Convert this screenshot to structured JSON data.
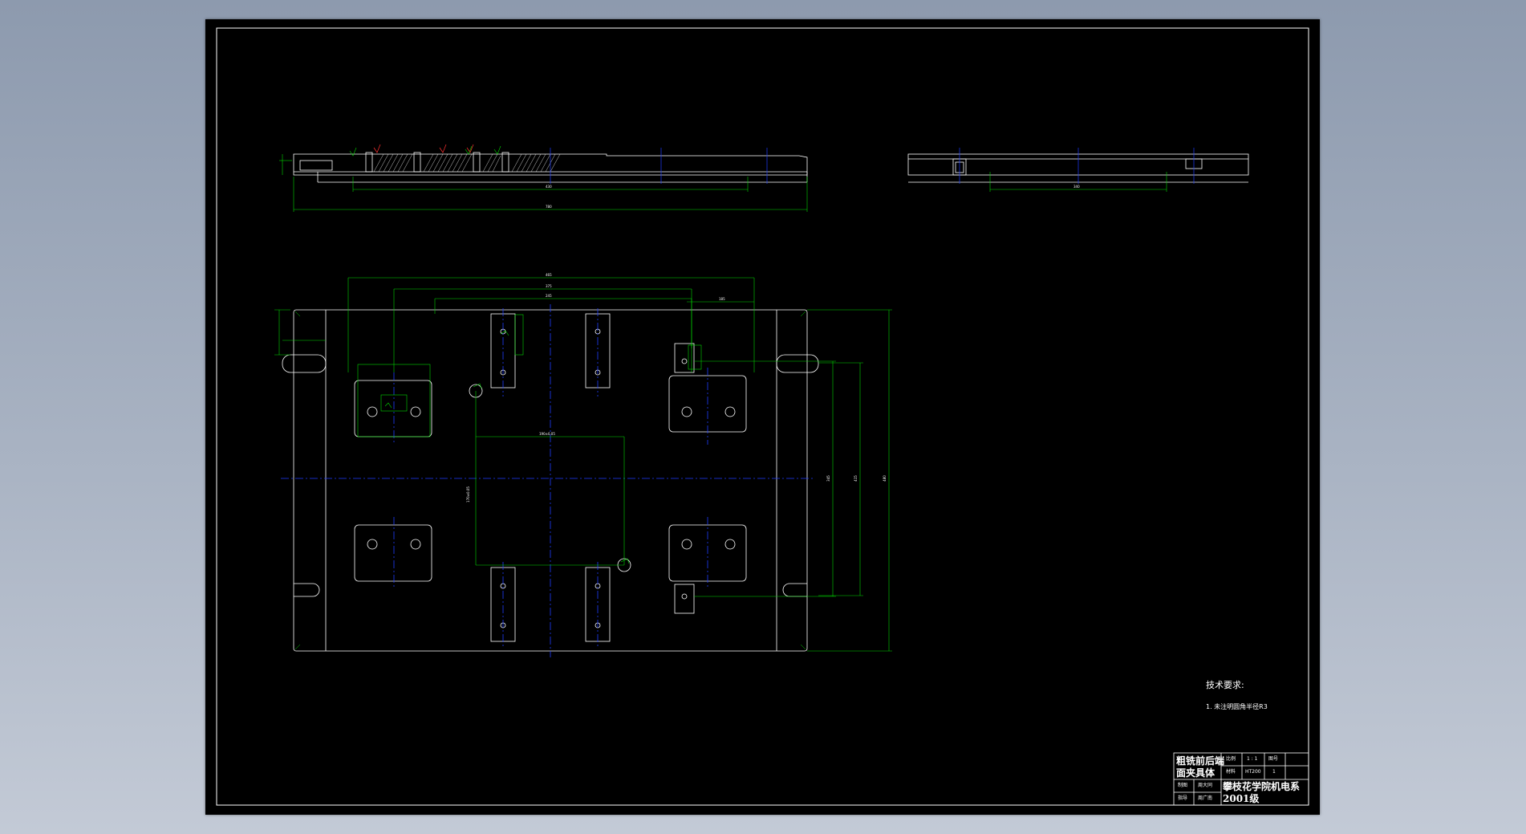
{
  "colors": {
    "background": "#000000",
    "outline": "#ffffff",
    "dimension": "#00d800",
    "centerline": "#1e3cff",
    "roughness_mark": "#ff3030"
  },
  "technical_requirements": {
    "heading": "技术要求:",
    "item_1": "1. 未注明圆角半径R3"
  },
  "title_block": {
    "part_name_line1": "粗铣前后端",
    "part_name_line2": "面夹具体",
    "scale_label": "比例",
    "scale_value": "1 : 1",
    "drawing_no_label": "图号",
    "material_label": "材料",
    "material_value": "HT200",
    "quantity_value": "1",
    "designer_label": "制图",
    "designer_name": "周大同",
    "reviewer_label": "指导",
    "reviewer_name": "周广南",
    "school_line1": "攀枝花学院机电系",
    "school_line2": "2001级"
  },
  "dimensions": {
    "front_view_inner": "430",
    "front_view_overall": "780",
    "side_view_width": "340",
    "plan_top_1": "465",
    "plan_top_2": "375",
    "plan_top_3": "245",
    "plan_top_4": "185",
    "plan_center_x": "190±0.05",
    "plan_center_y": "170±0.05",
    "plan_right_1": "345",
    "plan_right_2": "415",
    "plan_right_3": "480"
  }
}
